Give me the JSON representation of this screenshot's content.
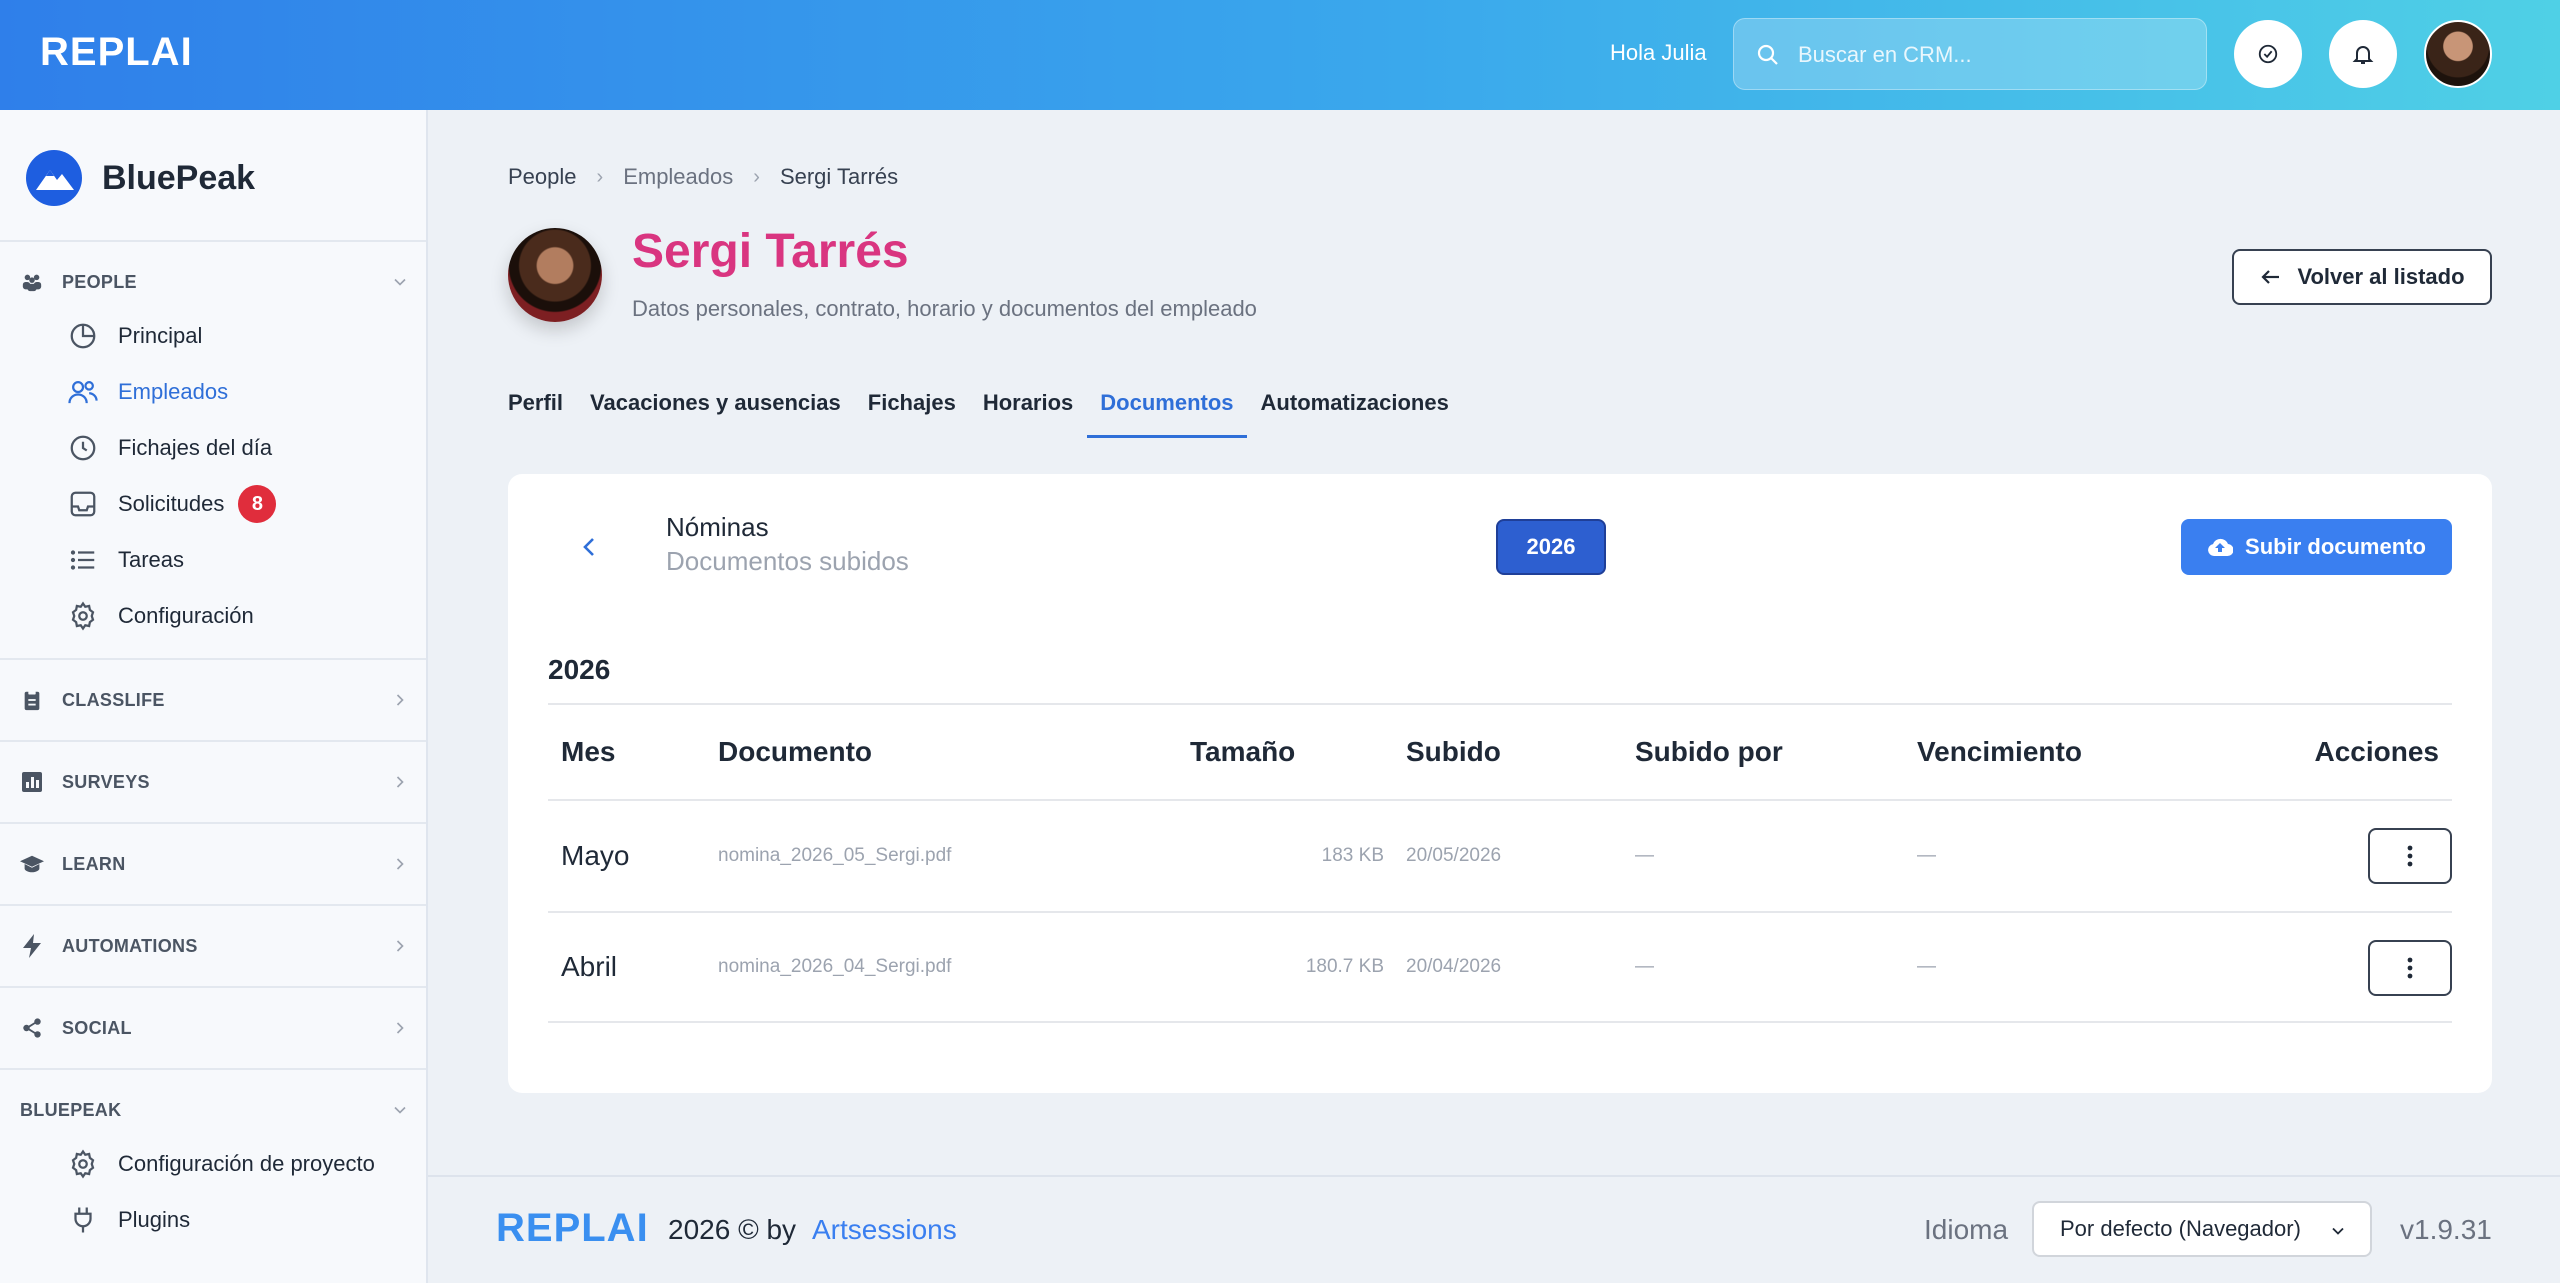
{
  "header": {
    "logo": "REPLAI",
    "greeting": "Hola Julia",
    "search_placeholder": "Buscar en CRM..."
  },
  "sidebar": {
    "brand": "BluePeak",
    "sections": [
      {
        "title": "PEOPLE",
        "expanded": true
      },
      {
        "title": "CLASSLIFE"
      },
      {
        "title": "SURVEYS"
      },
      {
        "title": "LEARN"
      },
      {
        "title": "AUTOMATIONS"
      },
      {
        "title": "SOCIAL"
      },
      {
        "title": "BLUEPEAK",
        "expanded": true
      }
    ],
    "people_items": [
      {
        "label": "Principal",
        "icon": "pie-chart-icon"
      },
      {
        "label": "Empleados",
        "icon": "users-icon",
        "active": true
      },
      {
        "label": "Fichajes del día",
        "icon": "clock-icon"
      },
      {
        "label": "Solicitudes",
        "icon": "inbox-icon",
        "badge": "8"
      },
      {
        "label": "Tareas",
        "icon": "list-icon"
      },
      {
        "label": "Configuración",
        "icon": "gear-icon"
      }
    ],
    "bluepeak_items": [
      {
        "label": "Configuración de proyecto",
        "icon": "gear-icon"
      },
      {
        "label": "Plugins",
        "icon": "plug-icon"
      }
    ]
  },
  "breadcrumb": [
    "People",
    "Empleados",
    "Sergi Tarrés"
  ],
  "profile": {
    "name": "Sergi Tarrés",
    "subtitle": "Datos personales, contrato, horario y documentos del empleado",
    "back_label": "Volver al listado"
  },
  "tabs": [
    "Perfil",
    "Vacaciones y ausencias",
    "Fichajes",
    "Horarios",
    "Documentos",
    "Automatizaciones"
  ],
  "active_tab": "Documentos",
  "documents": {
    "title": "Nóminas",
    "subtitle": "Documentos subidos",
    "year_button": "2026",
    "upload_label": "Subir documento",
    "year_heading": "2026",
    "columns": [
      "Mes",
      "Documento",
      "Tamaño",
      "Subido",
      "Subido por",
      "Vencimiento",
      "Acciones"
    ],
    "rows": [
      {
        "mes": "Mayo",
        "documento": "nomina_2026_05_Sergi.pdf",
        "tamano": "183 KB",
        "subido": "20/05/2026",
        "subido_por": "—",
        "vencimiento": "—"
      },
      {
        "mes": "Abril",
        "documento": "nomina_2026_04_Sergi.pdf",
        "tamano": "180.7 KB",
        "subido": "20/04/2026",
        "subido_por": "—",
        "vencimiento": "—"
      }
    ]
  },
  "footer": {
    "logo": "REPLAI",
    "copyright": "2026 © by",
    "link": "Artsessions",
    "language_label": "Idioma",
    "language_value": "Por defecto (Navegador)",
    "version": "v1.9.31"
  },
  "colors": {
    "accent": "#2f6fd8",
    "name_pink": "#d93580",
    "badge_red": "#e02d3c",
    "upload_blue": "#3a7ff0"
  }
}
